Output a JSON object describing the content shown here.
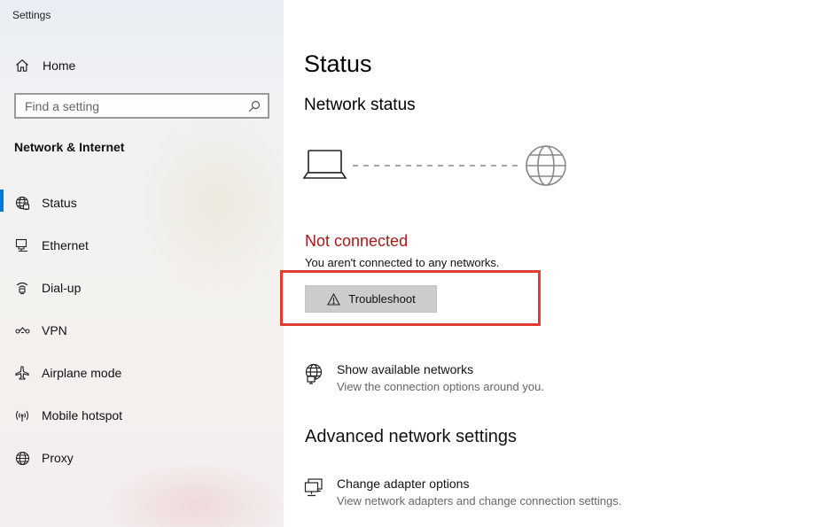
{
  "app": {
    "title": "Settings"
  },
  "sidebar": {
    "home_label": "Home",
    "search_placeholder": "Find a setting",
    "section_heading": "Network & Internet",
    "items": [
      {
        "label": "Status",
        "icon": "globe-network-icon",
        "active": true
      },
      {
        "label": "Ethernet",
        "icon": "ethernet-icon",
        "active": false
      },
      {
        "label": "Dial-up",
        "icon": "dial-up-icon",
        "active": false
      },
      {
        "label": "VPN",
        "icon": "vpn-icon",
        "active": false
      },
      {
        "label": "Airplane mode",
        "icon": "airplane-icon",
        "active": false
      },
      {
        "label": "Mobile hotspot",
        "icon": "hotspot-icon",
        "active": false
      },
      {
        "label": "Proxy",
        "icon": "globe-icon",
        "active": false
      }
    ]
  },
  "main": {
    "page_title": "Status",
    "network_status_heading": "Network status",
    "status_text": "Not connected",
    "status_description": "You aren't connected to any networks.",
    "troubleshoot_label": "Troubleshoot",
    "show_networks": {
      "title": "Show available networks",
      "description": "View the connection options around you."
    },
    "advanced_heading": "Advanced network settings",
    "change_adapter": {
      "title": "Change adapter options",
      "description": "View network adapters and change connection settings."
    }
  },
  "colors": {
    "accent": "#0078d7",
    "error_text": "#a61b1b",
    "highlight_border": "#e03c31",
    "button_bg": "#cccccc"
  }
}
